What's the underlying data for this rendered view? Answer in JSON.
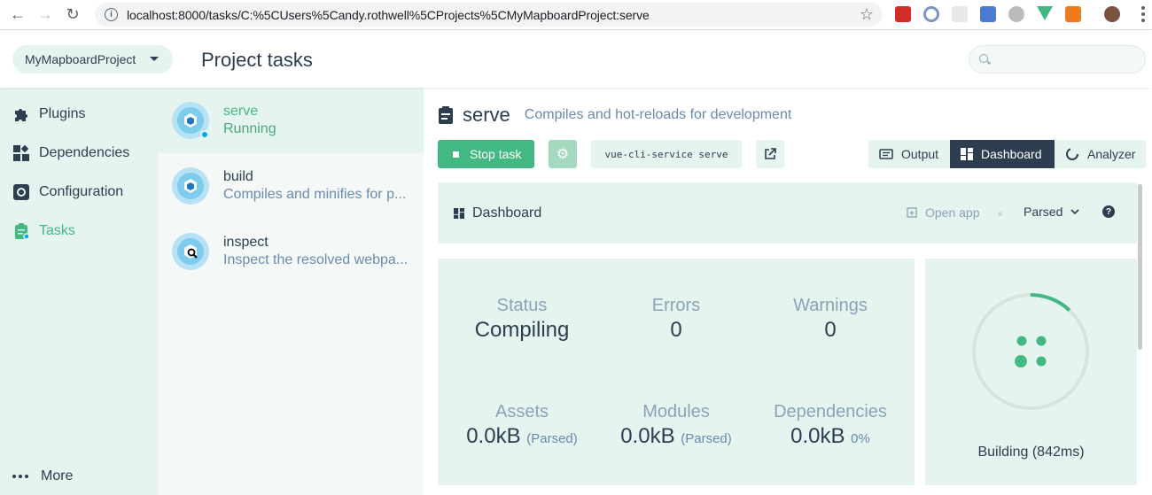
{
  "browser": {
    "url": "localhost:8000/tasks/C:%5CUsers%5Candy.rothwell%5CProjects%5CMyMapboardProject:serve"
  },
  "header": {
    "project_name": "MyMapboardProject",
    "page_title": "Project tasks"
  },
  "nav": {
    "items": [
      {
        "label": "Plugins",
        "icon": "puzzle-icon"
      },
      {
        "label": "Dependencies",
        "icon": "modules-icon"
      },
      {
        "label": "Configuration",
        "icon": "settings-icon"
      },
      {
        "label": "Tasks",
        "icon": "clipboard-icon"
      }
    ],
    "more_label": "More",
    "accent": "#42b983"
  },
  "tasks": [
    {
      "name": "serve",
      "desc": "Running"
    },
    {
      "name": "build",
      "desc": "Compiles and minifies for p..."
    },
    {
      "name": "inspect",
      "desc": "Inspect the resolved webpa..."
    }
  ],
  "task": {
    "title": "serve",
    "subtitle": "Compiles and hot-reloads for development",
    "stop_label": "Stop task",
    "command": "vue-cli-service serve",
    "tabs": [
      "Output",
      "Dashboard",
      "Analyzer"
    ]
  },
  "dashboard": {
    "title": "Dashboard",
    "open_app": "Open app",
    "mode": "Parsed",
    "stats": {
      "status_label": "Status",
      "status_value": "Compiling",
      "errors_label": "Errors",
      "errors_value": "0",
      "warnings_label": "Warnings",
      "warnings_value": "0",
      "assets_label": "Assets",
      "assets_value": "0.0kB",
      "assets_sub": "(Parsed)",
      "modules_label": "Modules",
      "modules_value": "0.0kB",
      "modules_sub": "(Parsed)",
      "deps_label": "Dependencies",
      "deps_value": "0.0kB",
      "deps_sub": "0%"
    },
    "progress_label": "Building (842ms)",
    "progress_fraction": 0.12
  }
}
